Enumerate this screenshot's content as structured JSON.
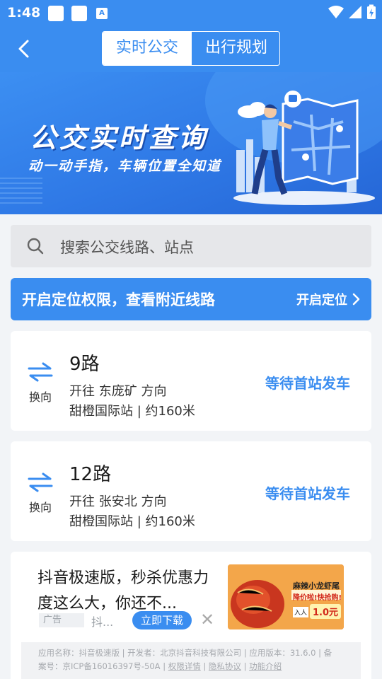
{
  "status_bar": {
    "time": "1:48",
    "notif_letter": "A"
  },
  "header": {
    "tabs": [
      {
        "label": "实时公交",
        "active": true
      },
      {
        "label": "出行规划",
        "active": false
      }
    ]
  },
  "banner": {
    "title": "公交实时查询",
    "subtitle": "动一动手指，车辆位置全知道"
  },
  "search": {
    "placeholder": "搜索公交线路、站点"
  },
  "location_prompt": {
    "message": "开启定位权限，查看附近线路",
    "button": "开启定位"
  },
  "routes": [
    {
      "swap_label": "换向",
      "name": "9路",
      "direction": "开往 东庞矿 方向",
      "stop": "甜橙国际站 | 约160米",
      "status": "等待首站发车"
    },
    {
      "swap_label": "换向",
      "name": "12路",
      "direction": "开往 张安北 方向",
      "stop": "甜橙国际站 | 约160米",
      "status": "等待首站发车"
    }
  ],
  "ad": {
    "title": "抖音极速版，秒杀优惠力度这么大，你还不...",
    "tag": "广告",
    "brand": "抖...",
    "download": "立即下载",
    "image_text": {
      "name": "麻辣小龙虾尾",
      "promo": "降价啦!快抢购!",
      "price_label": "入人",
      "price": "1.0元"
    },
    "footer": {
      "line1": "应用名称：抖音极速版 | 开发者：北京抖音科技有限公司 | 应用版本：31.6.0 | 备",
      "line2_prefix": "案号：京ICP备16016397号-50A | ",
      "permission": "权限详情",
      "privacy": "隐私协议",
      "features": "功能介绍"
    }
  },
  "colors": {
    "primary": "#3a8df0",
    "background": "#f2f4f7"
  }
}
